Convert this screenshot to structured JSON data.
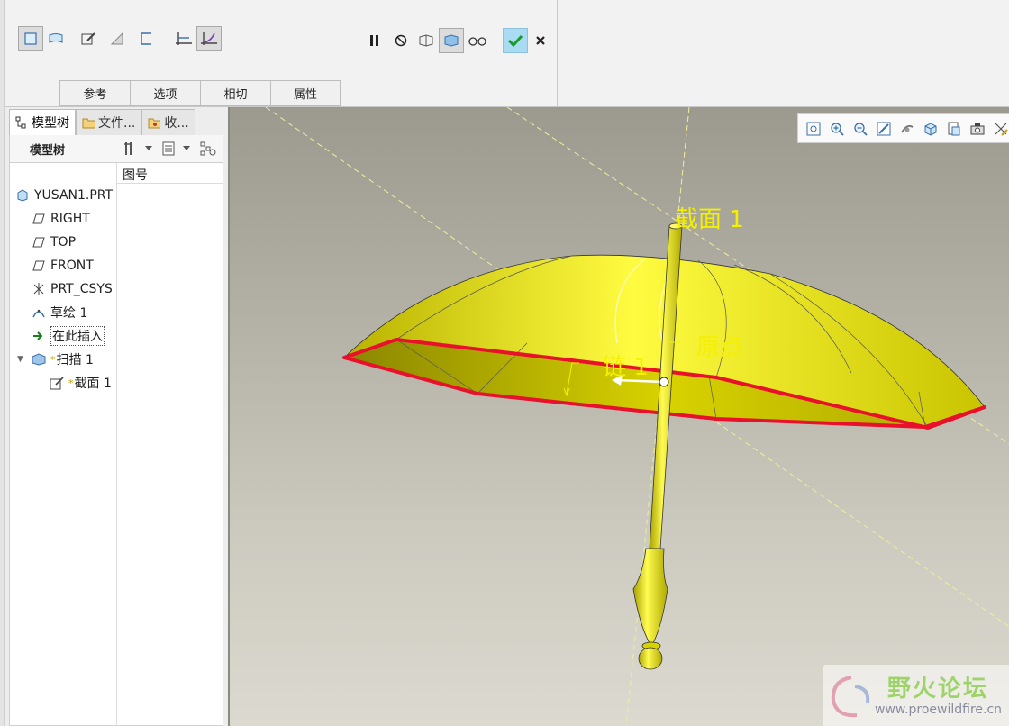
{
  "dashboard": {
    "option_tabs": [
      "参考",
      "选项",
      "相切",
      "属性"
    ]
  },
  "navigator": {
    "tabs": [
      "模型树",
      "文件...",
      "收..."
    ],
    "tree_title": "模型树",
    "column_header": "图号",
    "items": [
      {
        "label": "YUSAN1.PRT",
        "icon": "part-icon"
      },
      {
        "label": "RIGHT",
        "icon": "datum-plane-icon"
      },
      {
        "label": "TOP",
        "icon": "datum-plane-icon"
      },
      {
        "label": "FRONT",
        "icon": "datum-plane-icon"
      },
      {
        "label": "PRT_CSYS",
        "icon": "csys-icon"
      },
      {
        "label": "草绘 1",
        "icon": "sketch-curve-icon"
      },
      {
        "label": "在此插入",
        "icon": "insert-arrow-icon"
      },
      {
        "label": "扫描 1",
        "icon": "sweep-icon",
        "marker": "*"
      },
      {
        "label": "截面 1",
        "icon": "section-icon",
        "marker": "*"
      }
    ]
  },
  "viewport": {
    "labels": {
      "section": "截面 1",
      "origin": "原点",
      "chain": "链 1"
    },
    "colors": {
      "umbrella": "#f2ee00",
      "trajectory": "#e8102a",
      "datum_lines": "#f0ee9a"
    }
  },
  "watermark": {
    "title": "野火论坛",
    "url": "www.proewildfire.cn"
  }
}
